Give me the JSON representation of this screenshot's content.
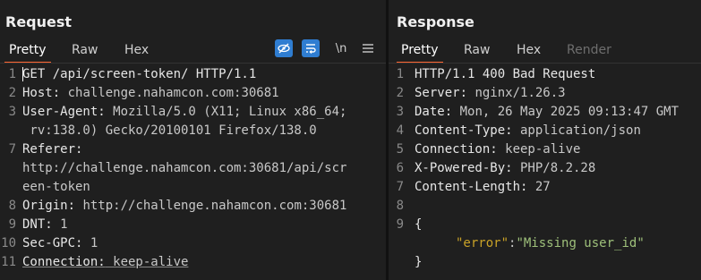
{
  "request": {
    "title": "Request",
    "tabs": [
      "Pretty",
      "Raw",
      "Hex"
    ],
    "tools": {
      "hide_icon": "eye-off-icon",
      "wrap_icon": "wrap-lines-icon",
      "newline_label": "\\n",
      "menu_icon": "hamburger-menu-icon"
    },
    "lines": [
      {
        "num": "1",
        "key": "GET /api/screen-token/ HTTP/1.1",
        "val": ""
      },
      {
        "num": "2",
        "key": "Host:",
        "val": " challenge.nahamcon.com:30681"
      },
      {
        "num": "3",
        "key": "User-Agent:",
        "val": " Mozilla/5.0 (X11; Linux x86_64;"
      },
      {
        "num": "",
        "key": "",
        "val": " rv:138.0) Gecko/20100101 Firefox/138.0"
      },
      {
        "num": "7",
        "key": "Referer:",
        "val": ""
      },
      {
        "num": "",
        "key": "",
        "val": "http://challenge.nahamcon.com:30681/api/scr"
      },
      {
        "num": "",
        "key": "",
        "val": "een-token"
      },
      {
        "num": "8",
        "key": "Origin:",
        "val": " http://challenge.nahamcon.com:30681"
      },
      {
        "num": "9",
        "key": "DNT:",
        "val": " 1"
      },
      {
        "num": "10",
        "key": "Sec-GPC:",
        "val": " 1"
      },
      {
        "num": "11",
        "key": "Connection:",
        "val": " keep-alive"
      }
    ]
  },
  "response": {
    "title": "Response",
    "tabs": [
      "Pretty",
      "Raw",
      "Hex",
      "Render"
    ],
    "lines": [
      {
        "num": "1",
        "key": "HTTP/1.1 400 Bad Request",
        "val": ""
      },
      {
        "num": "2",
        "key": "Server:",
        "val": " nginx/1.26.3"
      },
      {
        "num": "3",
        "key": "Date:",
        "val": " Mon, 26 May 2025 09:13:47 GMT"
      },
      {
        "num": "4",
        "key": "Content-Type:",
        "val": " application/json"
      },
      {
        "num": "5",
        "key": "Connection:",
        "val": " keep-alive"
      },
      {
        "num": "6",
        "key": "X-Powered-By:",
        "val": " PHP/8.2.28"
      },
      {
        "num": "7",
        "key": "Content-Length:",
        "val": " 27"
      },
      {
        "num": "8",
        "key": "",
        "val": ""
      },
      {
        "num": "9",
        "key": "{",
        "val": ""
      },
      {
        "num": "",
        "key": "",
        "val": ""
      },
      {
        "num": "",
        "key": "}",
        "val": ""
      }
    ],
    "json_key": "\"error\"",
    "json_colon": ":",
    "json_value": "\"Missing user_id\""
  }
}
